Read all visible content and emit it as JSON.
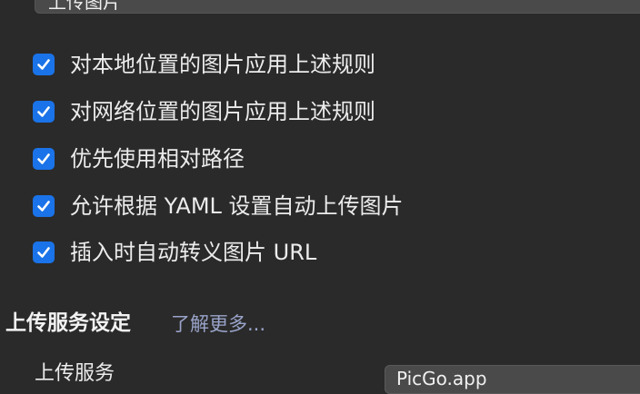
{
  "upload_dropdown": {
    "value": "上传图片"
  },
  "options": [
    {
      "label": "对本地位置的图片应用上述规则",
      "checked": true
    },
    {
      "label": "对网络位置的图片应用上述规则",
      "checked": true
    },
    {
      "label": "优先使用相对路径",
      "checked": true
    },
    {
      "label": "允许根据 YAML 设置自动上传图片",
      "checked": true
    },
    {
      "label": "插入时自动转义图片 URL",
      "checked": true
    }
  ],
  "upload_service_section": {
    "title": "上传服务设定",
    "learn_more": "了解更多...",
    "service_label": "上传服务",
    "service_value": "PicGo.app"
  },
  "colors": {
    "background": "#2a2a2a",
    "checkbox_accent": "#1a73e8",
    "link": "#9aa4c9"
  }
}
